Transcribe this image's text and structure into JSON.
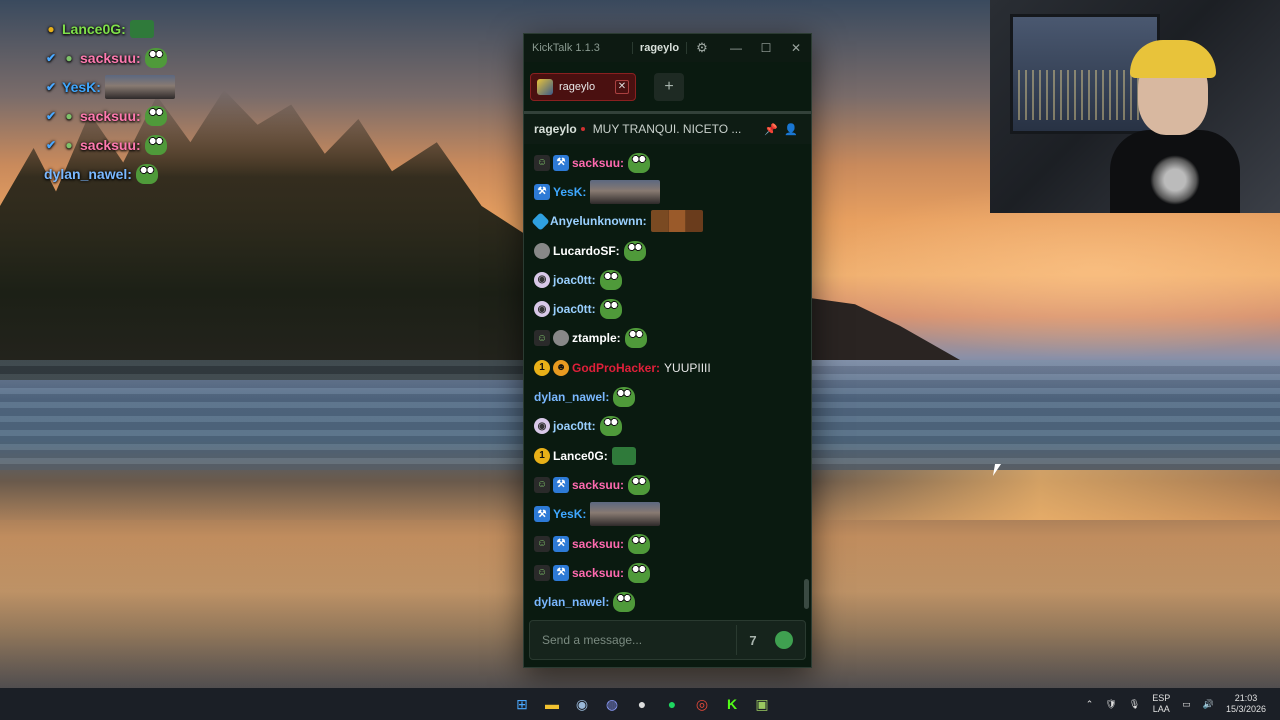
{
  "overlay_chat": [
    {
      "badges": [
        "one-badge"
      ],
      "user": "Lance0G:",
      "color": "#7fe04a",
      "emote": "box"
    },
    {
      "badges": [
        "mod-badge",
        "sub-badge"
      ],
      "user": "sacksuu:",
      "color": "#ff7ab0",
      "emote": "pepe"
    },
    {
      "badges": [
        "mod-badge"
      ],
      "user": "YesK:",
      "color": "#3fa8ff",
      "emote": "image"
    },
    {
      "badges": [
        "mod-badge",
        "sub-badge"
      ],
      "user": "sacksuu:",
      "color": "#ff7ab0",
      "emote": "pepe"
    },
    {
      "badges": [
        "mod-badge",
        "sub-badge"
      ],
      "user": "sacksuu:",
      "color": "#ff7ab0",
      "emote": "pepe"
    },
    {
      "badges": [],
      "user": "dylan_nawel:",
      "color": "#7ab8ff",
      "emote": "pepe"
    }
  ],
  "window": {
    "app_title": "KickTalk 1.1.3",
    "active_user": "rageylo",
    "minimize": "—",
    "maximize": "☐",
    "close": "✕"
  },
  "tabs": [
    {
      "label": "rageylo",
      "close": "✕"
    }
  ],
  "add_tab": "+",
  "channel": {
    "name": "rageylo",
    "stream_title": "MUY TRANQUI. NICETO ..."
  },
  "messages": [
    {
      "badges": [
        "sub",
        "mod"
      ],
      "user": "sacksuu:",
      "color": "#ff6ab0",
      "emote": "pepe",
      "text": ""
    },
    {
      "badges": [
        "mod"
      ],
      "user": "YesK:",
      "color": "#3fa8ff",
      "emote": "image",
      "text": ""
    },
    {
      "badges": [
        "vip"
      ],
      "user": "Anyelunknownn:",
      "color": "#9ad0ff",
      "emote": "faces",
      "text": ""
    },
    {
      "badges": [
        "gray"
      ],
      "user": "LucardoSF:",
      "color": "#ffffff",
      "emote": "pepe",
      "text": ""
    },
    {
      "badges": [
        "purple"
      ],
      "user": "joac0tt:",
      "color": "#9ad0ff",
      "emote": "pepe",
      "text": ""
    },
    {
      "badges": [
        "purple"
      ],
      "user": "joac0tt:",
      "color": "#9ad0ff",
      "emote": "pepe",
      "text": ""
    },
    {
      "badges": [
        "sub",
        "gray"
      ],
      "user": "ztample:",
      "color": "#ffffff",
      "emote": "pepe",
      "text": ""
    },
    {
      "badges": [
        "one",
        "orange"
      ],
      "user": "GodProHacker:",
      "color": "#e0203a",
      "emote": "",
      "text": "YUUPIIII"
    },
    {
      "badges": [],
      "user": "dylan_nawel:",
      "color": "#7ab8ff",
      "emote": "pepe",
      "text": ""
    },
    {
      "badges": [
        "purple"
      ],
      "user": "joac0tt:",
      "color": "#9ad0ff",
      "emote": "pepe",
      "text": ""
    },
    {
      "badges": [
        "one"
      ],
      "user": "Lance0G:",
      "color": "#ffffff",
      "emote": "box",
      "text": ""
    },
    {
      "badges": [
        "sub",
        "mod"
      ],
      "user": "sacksuu:",
      "color": "#ff6ab0",
      "emote": "pepe",
      "text": ""
    },
    {
      "badges": [
        "mod"
      ],
      "user": "YesK:",
      "color": "#3fa8ff",
      "emote": "image",
      "text": ""
    },
    {
      "badges": [
        "sub",
        "mod"
      ],
      "user": "sacksuu:",
      "color": "#ff6ab0",
      "emote": "pepe",
      "text": ""
    },
    {
      "badges": [
        "sub",
        "mod"
      ],
      "user": "sacksuu:",
      "color": "#ff6ab0",
      "emote": "pepe",
      "text": ""
    },
    {
      "badges": [],
      "user": "dylan_nawel:",
      "color": "#7ab8ff",
      "emote": "pepe",
      "text": ""
    }
  ],
  "input": {
    "placeholder": "Send a message..."
  },
  "taskbar": {
    "apps": [
      "windows-start",
      "file-explorer",
      "steam",
      "discord",
      "obs",
      "spotify",
      "chrome",
      "kick",
      "kicktalk"
    ],
    "tray": {
      "lang_top": "ESP",
      "lang_bottom": "LAA",
      "time": "21:03",
      "date": "15/3/2026"
    }
  }
}
